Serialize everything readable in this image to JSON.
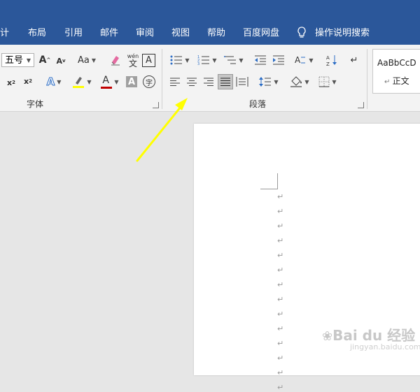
{
  "menubar": {
    "items": [
      "计",
      "布局",
      "引用",
      "邮件",
      "审阅",
      "视图",
      "帮助",
      "百度网盘"
    ],
    "search_label": "操作说明搜索",
    "bg_color": "#2b579a"
  },
  "ribbon": {
    "font_group": {
      "label": "字体",
      "font_size": "五号",
      "case_label": "Aa",
      "phonetic_top": "wén",
      "phonetic_bottom": "文",
      "border_char": "A",
      "font_color_char": "A",
      "shading_char": "A",
      "enclose_char": "字",
      "highlight_color": "#ffff00",
      "font_color": "#c00000"
    },
    "paragraph_group": {
      "label": "段落"
    },
    "styles_group": {
      "sample": "AaBbCcD",
      "style_name": "正文"
    }
  },
  "document": {
    "paragraph_mark": "↵",
    "line_count": 14
  },
  "watermark": {
    "text": "Bai du 经验",
    "sub": "jingyan.baidu.com"
  },
  "annotation": {
    "color": "#ffff00"
  }
}
